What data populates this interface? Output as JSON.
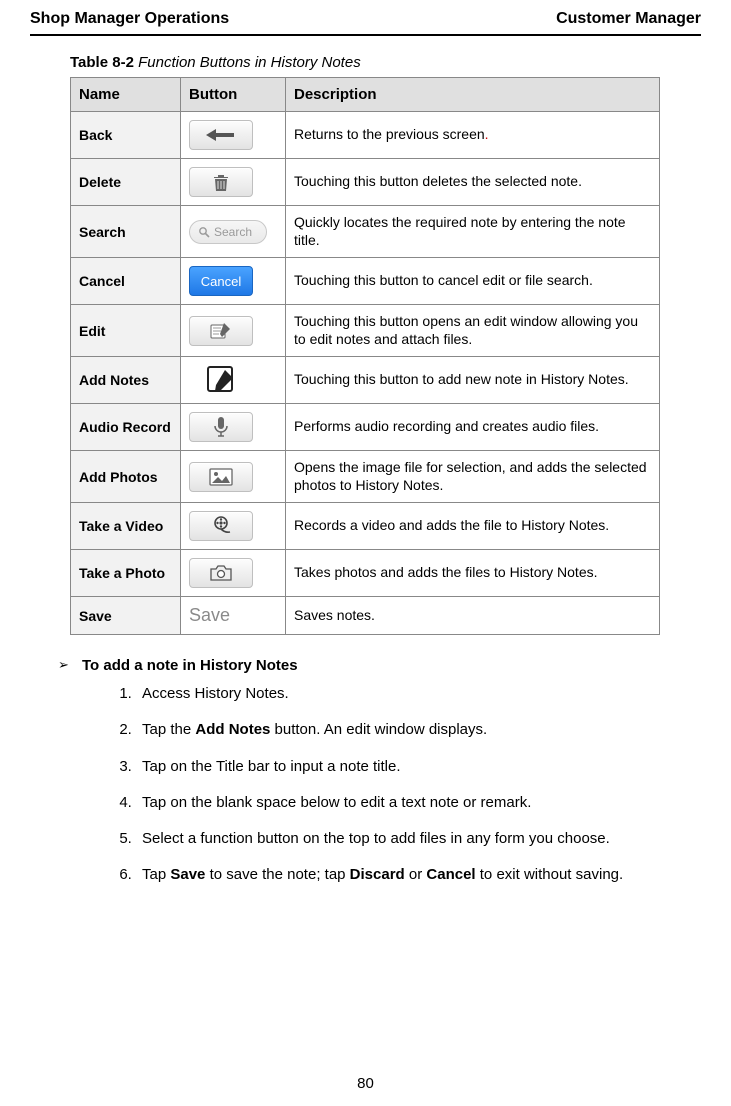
{
  "header": {
    "left": "Shop Manager Operations",
    "right": "Customer Manager"
  },
  "caption": {
    "num": "Table 8-2",
    "title": "Function Buttons in History Notes"
  },
  "cols": {
    "c1": "Name",
    "c2": "Button",
    "c3": "Description"
  },
  "rows": [
    {
      "name": "Back",
      "btn": "back",
      "desc_pre": "Returns to the previous screen",
      "desc_red": ".",
      "desc_post": ""
    },
    {
      "name": "Delete",
      "btn": "delete",
      "desc": "Touching this button deletes the selected note."
    },
    {
      "name": "Search",
      "btn": "search",
      "search_label": "Search",
      "desc": "Quickly locates the required note by entering the note title."
    },
    {
      "name": "Cancel",
      "btn": "cancel",
      "cancel_label": "Cancel",
      "desc": "Touching this button to cancel edit or file search."
    },
    {
      "name": "Edit",
      "btn": "edit",
      "desc": "Touching this button opens an edit window allowing you to edit notes and attach files."
    },
    {
      "name": "Add Notes",
      "btn": "addnotes",
      "desc": "Touching this button to add new note in History Notes."
    },
    {
      "name": "Audio Record",
      "btn": "audio",
      "desc": "Performs audio recording and creates audio files."
    },
    {
      "name": "Add Photos",
      "btn": "photos",
      "desc": "Opens the image file for selection, and adds the selected photos to History Notes."
    },
    {
      "name": "Take a Video",
      "btn": "video",
      "desc": "Records a video and adds the file to History Notes."
    },
    {
      "name": "Take a Photo",
      "btn": "camera",
      "desc": "Takes photos and adds the files to History Notes."
    },
    {
      "name": "Save",
      "btn": "save",
      "save_label": "Save",
      "desc": "Saves notes."
    }
  ],
  "procedure": {
    "title": "To add a note in History Notes",
    "steps": {
      "s1": "Access History Notes.",
      "s2_a": "Tap the ",
      "s2_b": "Add Notes",
      "s2_c": " button. An edit window displays.",
      "s3": "Tap on the Title bar to input a note title.",
      "s4": "Tap on the blank space below to edit a text note or remark.",
      "s5": "Select a function button on the top to add files in any form you choose.",
      "s6_a": "Tap ",
      "s6_b": "Save",
      "s6_c": " to save the note; tap ",
      "s6_d": "Discard",
      "s6_e": " or ",
      "s6_f": "Cancel",
      "s6_g": " to exit without saving."
    }
  },
  "pagenum": "80"
}
